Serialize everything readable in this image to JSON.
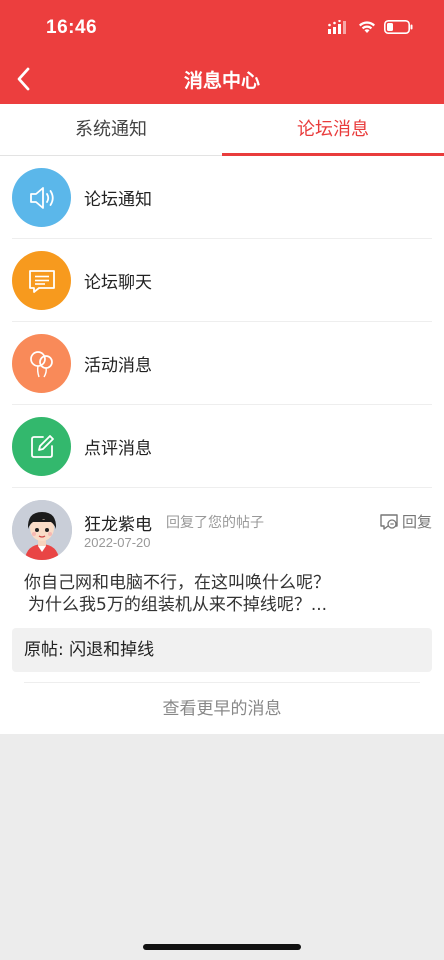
{
  "status_bar": {
    "time": "16:46"
  },
  "header": {
    "title": "消息中心"
  },
  "tabs": [
    {
      "label": "系统通知",
      "active": false
    },
    {
      "label": "论坛消息",
      "active": true
    }
  ],
  "categories": [
    {
      "label": "论坛通知",
      "icon": "speaker-icon",
      "color": "#5bb7ea"
    },
    {
      "label": "论坛聊天",
      "icon": "chat-bubble-icon",
      "color": "#f79a1e"
    },
    {
      "label": "活动消息",
      "icon": "balloons-icon",
      "color": "#f98a59"
    },
    {
      "label": "点评消息",
      "icon": "edit-icon",
      "color": "#33b86d"
    }
  ],
  "post": {
    "author": "狂龙紫电",
    "action": "回复了您的帖子",
    "date": "2022-07-20",
    "reply_label": "回复",
    "content_line1": "你自己网和电脑不行，在这叫唤什么呢？",
    "content_line2": "为什么我5万的组装机从来不掉线呢？...",
    "original": "原帖: 闪退和掉线"
  },
  "more_label": "查看更早的消息"
}
